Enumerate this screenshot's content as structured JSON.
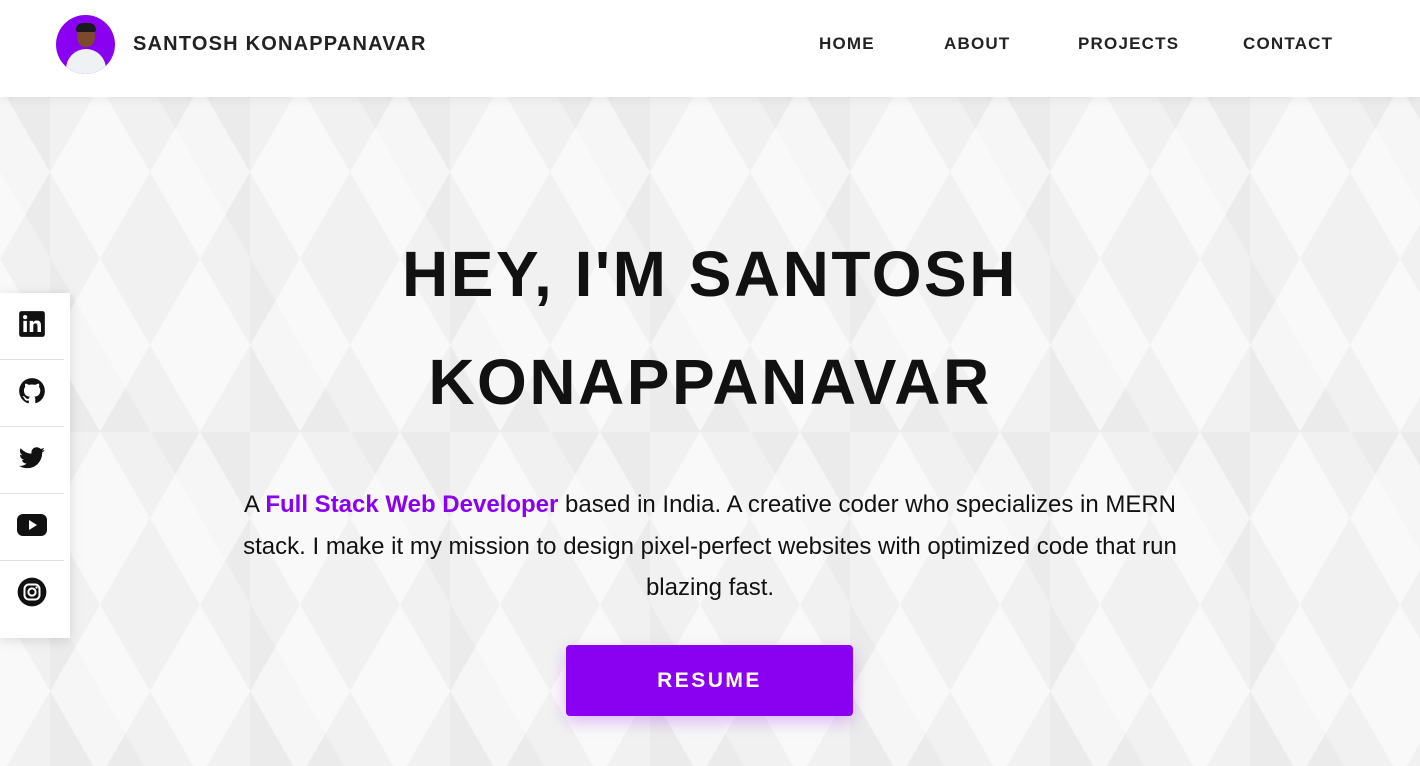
{
  "header": {
    "brand_name": "SANTOSH KONAPPANAVAR",
    "nav": [
      {
        "label": "HOME"
      },
      {
        "label": "ABOUT"
      },
      {
        "label": "PROJECTS"
      },
      {
        "label": "CONTACT"
      }
    ]
  },
  "social": [
    {
      "icon": "linkedin-icon"
    },
    {
      "icon": "github-icon"
    },
    {
      "icon": "twitter-icon"
    },
    {
      "icon": "youtube-icon"
    },
    {
      "icon": "instagram-icon"
    }
  ],
  "hero": {
    "title_line1": "HEY, I'M SANTOSH",
    "title_line2": "KONAPPANAVAR",
    "desc_prefix": "A ",
    "desc_highlight": "Full Stack Web Developer",
    "desc_rest": " based in India. A creative coder who specializes in MERN stack. I make it my mission to design pixel-perfect websites with optimized code that run blazing fast.",
    "button_label": "RESUME"
  },
  "colors": {
    "accent": "#8a00f0",
    "background": "#f1f1f1",
    "text": "#111111"
  }
}
